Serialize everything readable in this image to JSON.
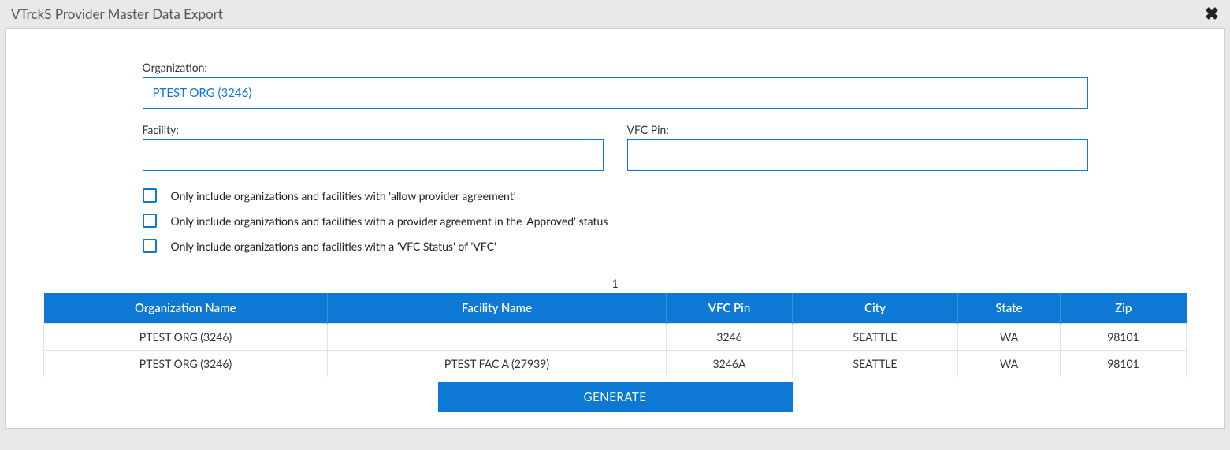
{
  "title": "VTrckS Provider Master Data Export",
  "form": {
    "organization": {
      "label": "Organization:",
      "value": "PTEST ORG (3246)"
    },
    "facility": {
      "label": "Facility:",
      "value": ""
    },
    "vfcpin": {
      "label": "VFC Pin:",
      "value": ""
    },
    "checks": [
      "Only include organizations and facilities with 'allow provider agreement'",
      "Only include organizations and facilities with a provider agreement in the 'Approved' status",
      "Only include organizations and facilities with a 'VFC Status' of 'VFC'"
    ]
  },
  "pager": "1",
  "table": {
    "headers": [
      "Organization Name",
      "Facility Name",
      "VFC Pin",
      "City",
      "State",
      "Zip"
    ],
    "rows": [
      {
        "org": "PTEST ORG (3246)",
        "fac": "",
        "pin": "3246",
        "city": "SEATTLE",
        "state": "WA",
        "zip": "98101"
      },
      {
        "org": "PTEST ORG (3246)",
        "fac": "PTEST FAC A (27939)",
        "pin": "3246A",
        "city": "SEATTLE",
        "state": "WA",
        "zip": "98101"
      }
    ]
  },
  "buttons": {
    "generate": "GENERATE"
  }
}
